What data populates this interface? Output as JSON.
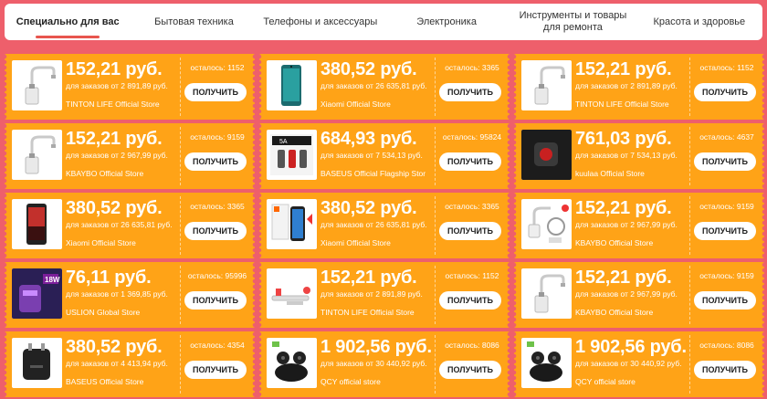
{
  "tabs": [
    {
      "label": "Специально для вас",
      "active": true
    },
    {
      "label": "Бытовая техника",
      "active": false
    },
    {
      "label": "Телефоны и аксессуары",
      "active": false
    },
    {
      "label": "Электроника",
      "active": false
    },
    {
      "label": "Инструменты и товары для ремонта",
      "active": false
    },
    {
      "label": "Красота и здоровье",
      "active": false
    }
  ],
  "coupons": [
    {
      "image": "faucet-heater",
      "price": "152,21 руб.",
      "min_order": "для заказов от 2 891,89 руб.",
      "store": "TINTON LIFE Official Store",
      "remaining": "осталось: 1152",
      "button": "ПОЛУЧИТЬ"
    },
    {
      "image": "xiaomi-phone-teal",
      "price": "380,52 руб.",
      "min_order": "для заказов от 26 635,81 руб.",
      "store": "Xiaomi Official Store",
      "remaining": "осталось: 3365",
      "button": "ПОЛУЧИТЬ"
    },
    {
      "image": "faucet-heater",
      "price": "152,21 руб.",
      "min_order": "для заказов от 2 891,89 руб.",
      "store": "TINTON LIFE Official Store",
      "remaining": "осталось: 1152",
      "button": "ПОЛУЧИТЬ"
    },
    {
      "image": "faucet-heater",
      "price": "152,21 руб.",
      "min_order": "для заказов от 2 967,99 руб.",
      "store": "KBAYBO Official Store",
      "remaining": "осталось: 9159",
      "button": "ПОЛУЧИТЬ"
    },
    {
      "image": "car-charger-box",
      "price": "684,93 руб.",
      "min_order": "для заказов от 7 534,13 руб.",
      "store": "BASEUS Official Flagship Stor",
      "remaining": "осталось: 95824",
      "button": "ПОЛУЧИТЬ"
    },
    {
      "image": "car-gadget",
      "price": "761,03 руб.",
      "min_order": "для заказов от 7 534,13 руб.",
      "store": "kuulaa Official Store",
      "remaining": "осталось: 4637",
      "button": "ПОЛУЧИТЬ"
    },
    {
      "image": "xiaomi-phone-black",
      "price": "380,52 руб.",
      "min_order": "для заказов от 26 635,81 руб.",
      "store": "Xiaomi Official Store",
      "remaining": "осталось: 3365",
      "button": "ПОЛУЧИТЬ"
    },
    {
      "image": "xiaomi-phone-box",
      "price": "380,52 руб.",
      "min_order": "для заказов от 26 635,81 руб.",
      "store": "Xiaomi Official Store",
      "remaining": "осталось: 3365",
      "button": "ПОЛУЧИТЬ"
    },
    {
      "image": "faucet-set",
      "price": "152,21 руб.",
      "min_order": "для заказов от 2 967,99 руб.",
      "store": "KBAYBO Official Store",
      "remaining": "осталось: 9159",
      "button": "ПОЛУЧИТЬ"
    },
    {
      "image": "charger-18w",
      "price": "76,11 руб.",
      "min_order": "для заказов от 1 369,85 руб.",
      "store": "USLION Global Store",
      "remaining": "осталось: 95996",
      "button": "ПОЛУЧИТЬ"
    },
    {
      "image": "faucet-parts",
      "price": "152,21 руб.",
      "min_order": "для заказов от 2 891,89 руб.",
      "store": "TINTON LIFE Official Store",
      "remaining": "осталось: 1152",
      "button": "ПОЛУЧИТЬ"
    },
    {
      "image": "faucet-heater",
      "price": "152,21 руб.",
      "min_order": "для заказов от 2 967,99 руб.",
      "store": "KBAYBO Official Store",
      "remaining": "осталось: 9159",
      "button": "ПОЛУЧИТЬ"
    },
    {
      "image": "wall-charger",
      "price": "380,52 руб.",
      "min_order": "для заказов от 4 413,94 руб.",
      "store": "BASEUS Official Store",
      "remaining": "осталось: 4354",
      "button": "ПОЛУЧИТЬ"
    },
    {
      "image": "earbuds",
      "price": "1 902,56 руб.",
      "min_order": "для заказов от 30 440,92 руб.",
      "store": "QCY official store",
      "remaining": "осталось: 8086",
      "button": "ПОЛУЧИТЬ"
    },
    {
      "image": "earbuds",
      "price": "1 902,56 руб.",
      "min_order": "для заказов от 30 440,92 руб.",
      "store": "QCY official store",
      "remaining": "осталось: 8086",
      "button": "ПОЛУЧИТЬ"
    }
  ]
}
